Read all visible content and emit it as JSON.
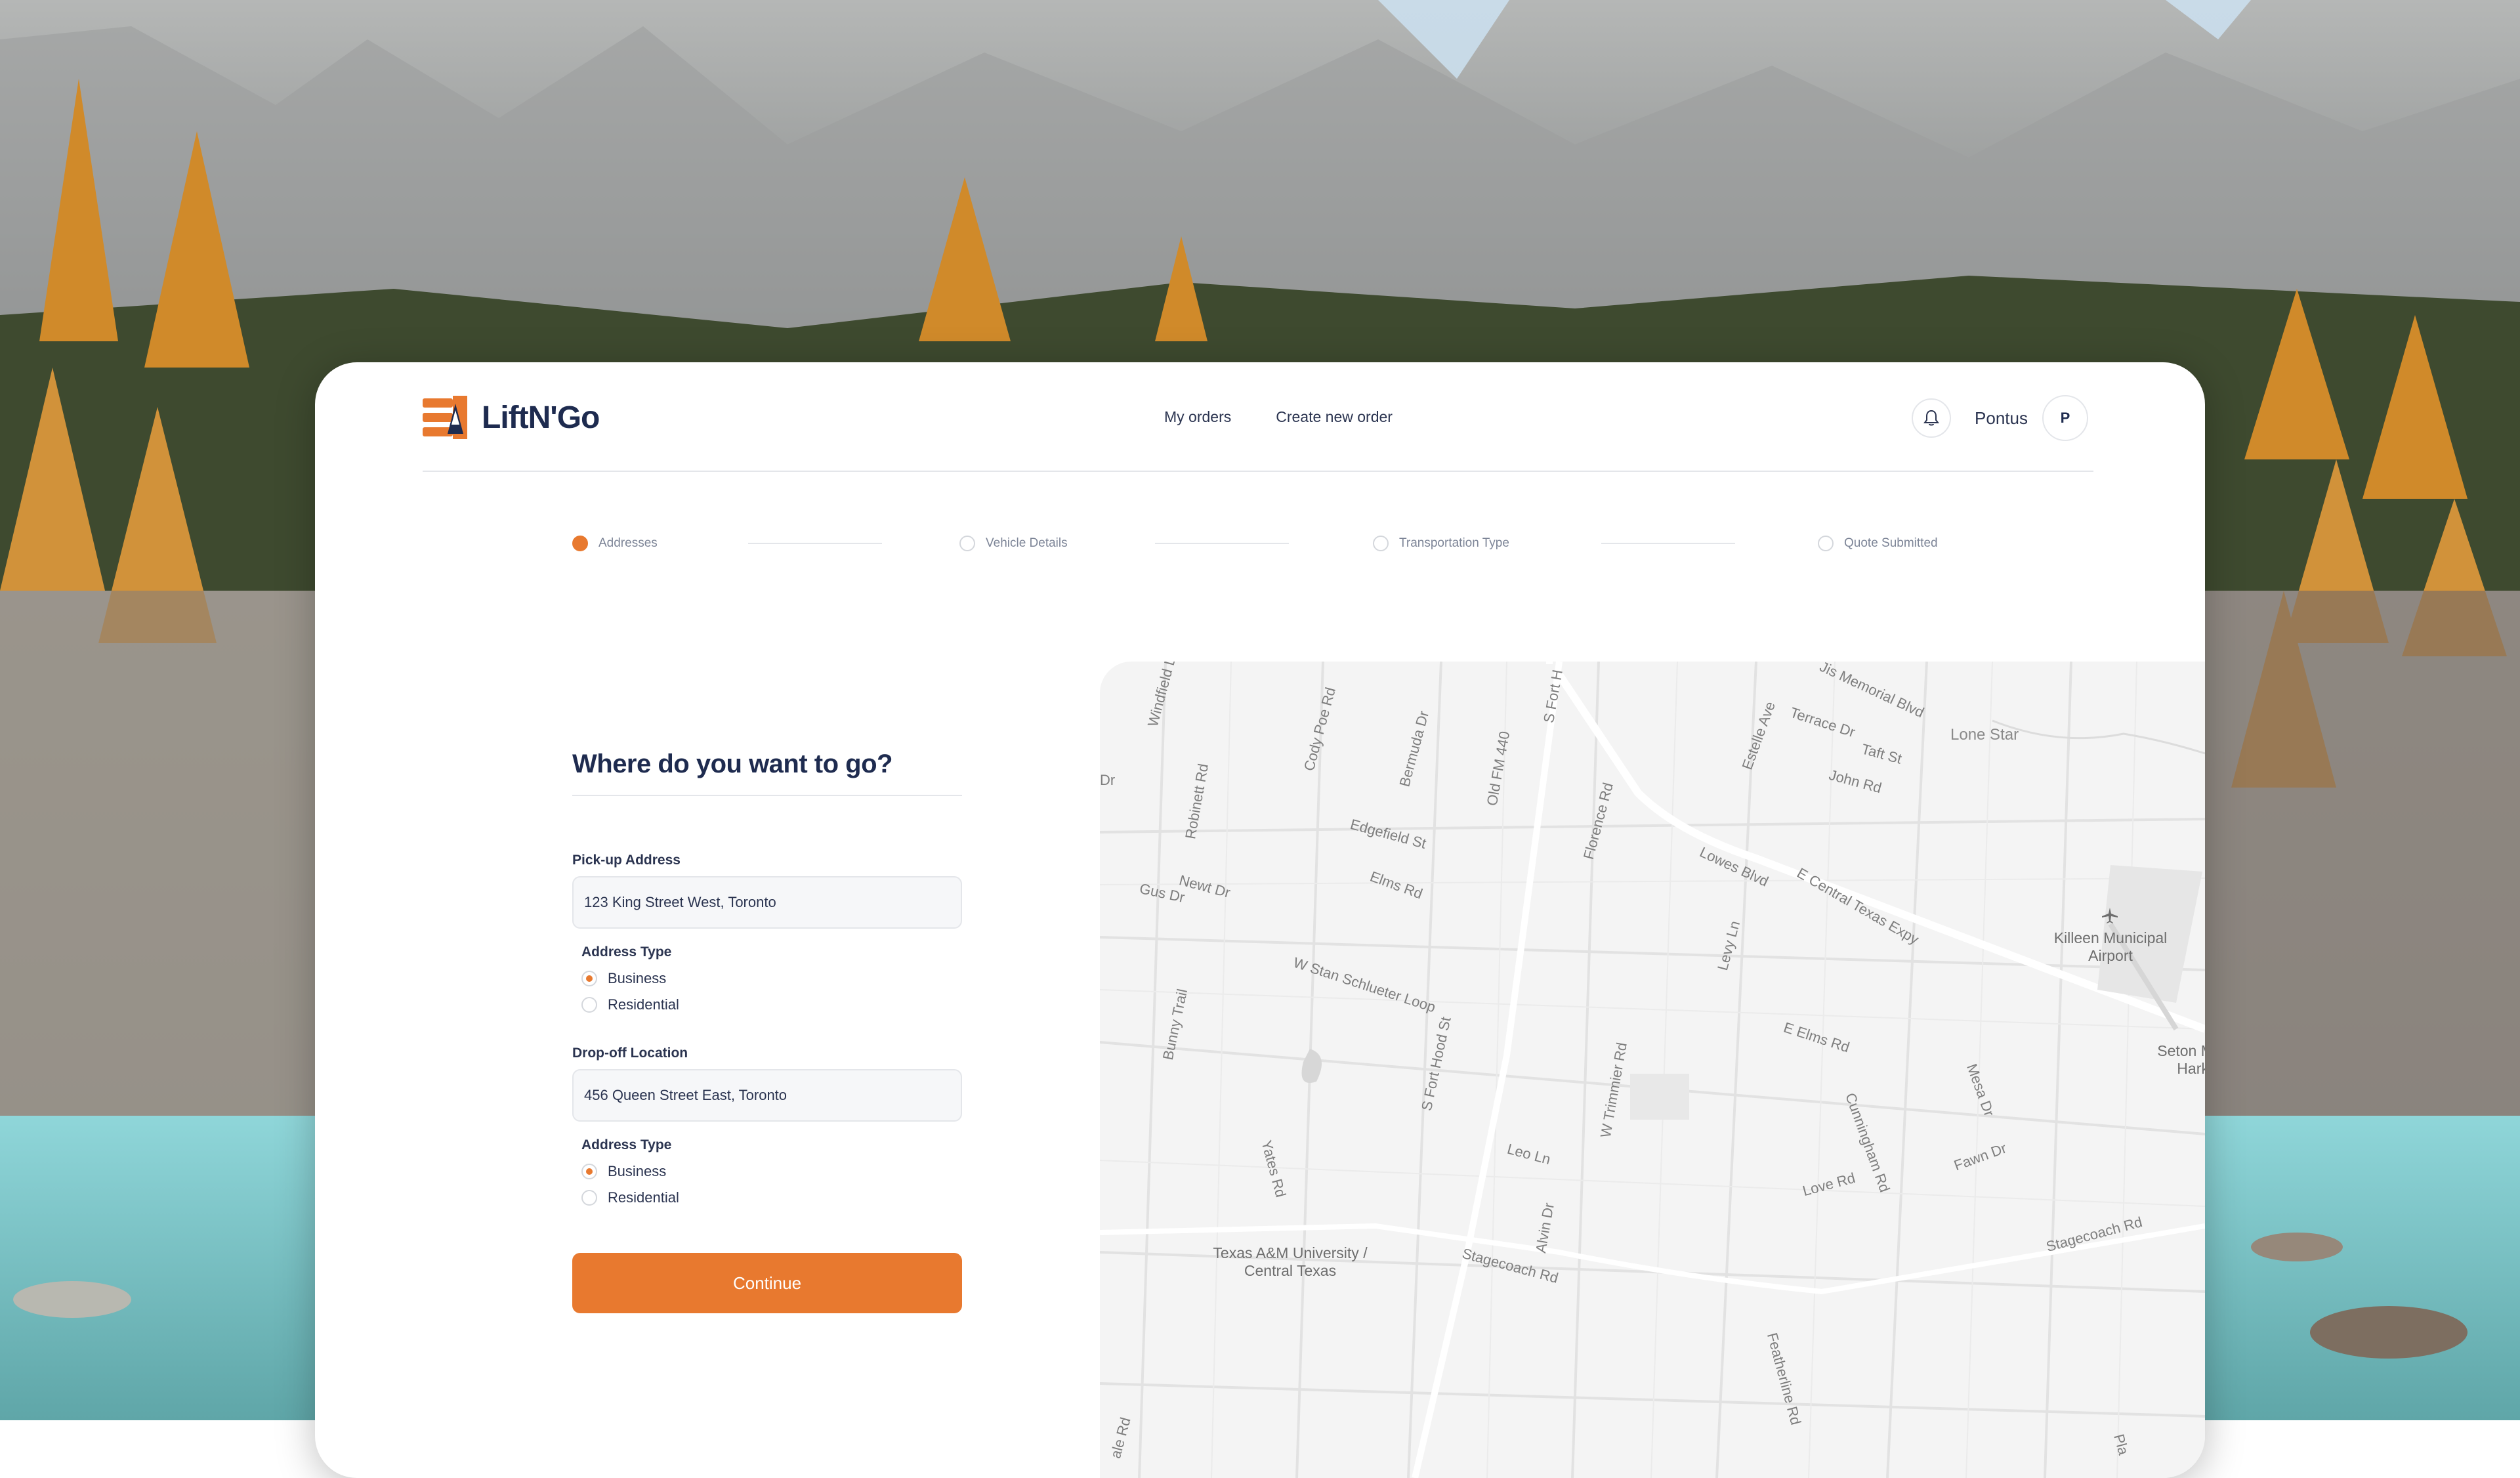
{
  "app": {
    "brand": "LiftN'Go",
    "colors": {
      "accent": "#e8792f",
      "navy": "#1e2b4f"
    }
  },
  "nav": {
    "my_orders": "My orders",
    "create_order": "Create new order"
  },
  "user": {
    "name": "Pontus",
    "initial": "P",
    "bell_icon": "bell-icon"
  },
  "stepper": {
    "steps": [
      {
        "label": "Addresses",
        "state": "active"
      },
      {
        "label": "Vehicle Details",
        "state": "pending"
      },
      {
        "label": "Transportation Type",
        "state": "pending"
      },
      {
        "label": "Quote Submitted",
        "state": "pending"
      }
    ]
  },
  "form": {
    "title": "Where do you want to go?",
    "pickup": {
      "label": "Pick-up Address",
      "value": "123 King Street West, Toronto",
      "type_label": "Address Type",
      "options": [
        "Business",
        "Residential"
      ],
      "selected": "Business"
    },
    "dropoff": {
      "label": "Drop-off Location",
      "value": "456 Queen Street East, Toronto",
      "type_label": "Address Type",
      "options": [
        "Business",
        "Residential"
      ],
      "selected": "Business"
    },
    "continue_label": "Continue"
  },
  "map": {
    "streets": [
      "Windfield Dr",
      "Cody Poe Rd",
      "Bermuda Dr",
      "Old FM 440",
      "S Fort H",
      "Jis Memorial Blvd",
      "Terrace Dr",
      "Estelle Ave",
      "Taft St",
      "John Rd",
      "Lone Star",
      "Dr",
      "Robinett Rd",
      "Edgefield St",
      "Florence Rd",
      "Lowes Blvd",
      "E Central Texas Expy",
      "Newt Dr",
      "Gus Dr",
      "Elms Rd",
      "Levy Ln",
      "W Stan Schlueter Loop",
      "Bunny Trail",
      "S Fort Hood St",
      "E Elms Rd",
      "W Trimmier Rd",
      "Cunningham Rd",
      "Mesa Dr",
      "Leo Ln",
      "Fawn Dr",
      "Love Rd",
      "Yates Rd",
      "Alvin Dr",
      "Stagecoach Rd",
      "Stagecoach Rd",
      "Featherline Rd",
      "ale Rd",
      "Pla"
    ],
    "pois": {
      "airport": "Killeen Municipal Airport",
      "medical": "Seton Medical Cente Harker Heights",
      "university": "Texas A&M University / Central Texas"
    }
  }
}
